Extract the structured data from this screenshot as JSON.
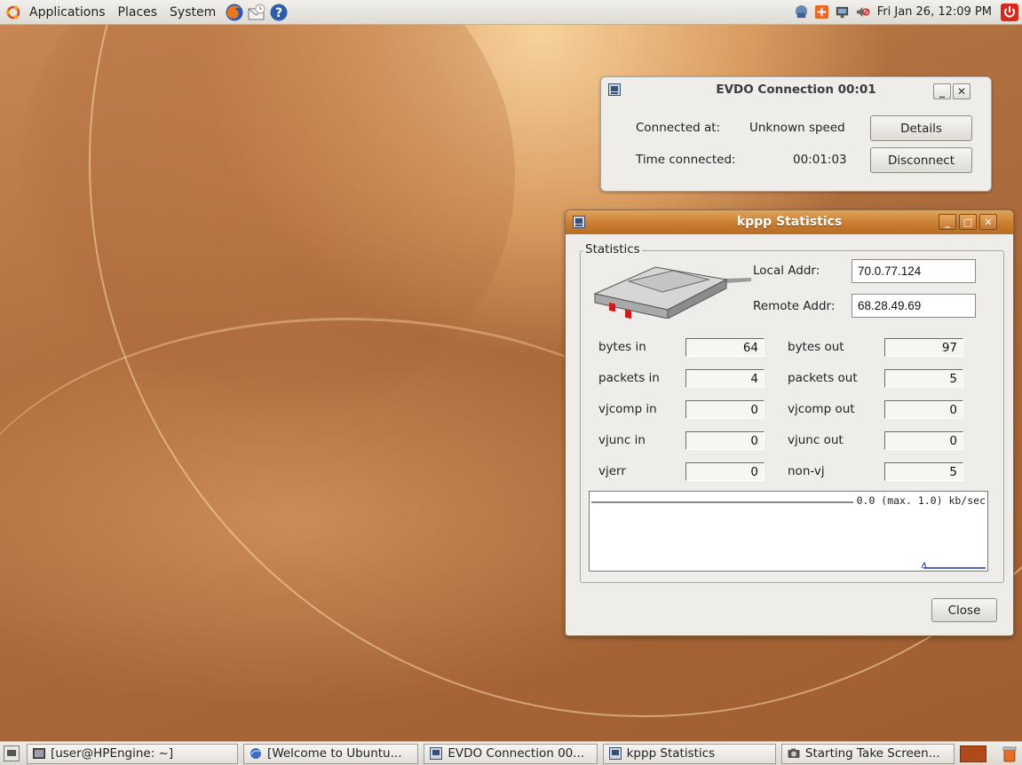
{
  "top_panel": {
    "menus": [
      "Applications",
      "Places",
      "System"
    ],
    "clock": "Fri Jan 26, 12:09 PM",
    "launchers": [
      "firefox-icon",
      "mail-icon",
      "help-icon"
    ]
  },
  "evdo_window": {
    "title": "EVDO Connection 00:01",
    "connected_at_label": "Connected at:",
    "connected_at_value": "Unknown speed",
    "time_connected_label": "Time connected:",
    "time_connected_value": "00:01:03",
    "details_button": "Details",
    "disconnect_button": "Disconnect"
  },
  "kppp_window": {
    "title": "kppp Statistics",
    "group_title": "Statistics",
    "local_addr_label": "Local Addr:",
    "local_addr": "70.0.77.124",
    "remote_addr_label": "Remote Addr:",
    "remote_addr": "68.28.49.69",
    "stats": [
      {
        "left_label": "bytes in",
        "left_value": "64",
        "right_label": "bytes out",
        "right_value": "97"
      },
      {
        "left_label": "packets in",
        "left_value": "4",
        "right_label": "packets out",
        "right_value": "5"
      },
      {
        "left_label": "vjcomp in",
        "left_value": "0",
        "right_label": "vjcomp out",
        "right_value": "0"
      },
      {
        "left_label": "vjunc in",
        "left_value": "0",
        "right_label": "vjunc out",
        "right_value": "0"
      },
      {
        "left_label": "vjerr",
        "left_value": "0",
        "right_label": "non-vj",
        "right_value": "5"
      }
    ],
    "graph_caption": "0.0 (max. 1.0) kb/sec",
    "close_button": "Close"
  },
  "taskbar": {
    "tasks": [
      {
        "label": "[user@HPEngine: ~]",
        "icon": "terminal-icon"
      },
      {
        "label": "[Welcome to Ubuntu...",
        "icon": "browser-icon"
      },
      {
        "label": "EVDO Connection 00...",
        "icon": "network-app-icon"
      },
      {
        "label": "kppp Statistics",
        "icon": "network-app-icon"
      },
      {
        "label": "Starting Take Screen...",
        "icon": "camera-icon"
      }
    ]
  },
  "colors": {
    "titlebar_active": "#c97d30",
    "wallpaper": "#b06f3e",
    "graph_line": "#1a2fb8"
  }
}
